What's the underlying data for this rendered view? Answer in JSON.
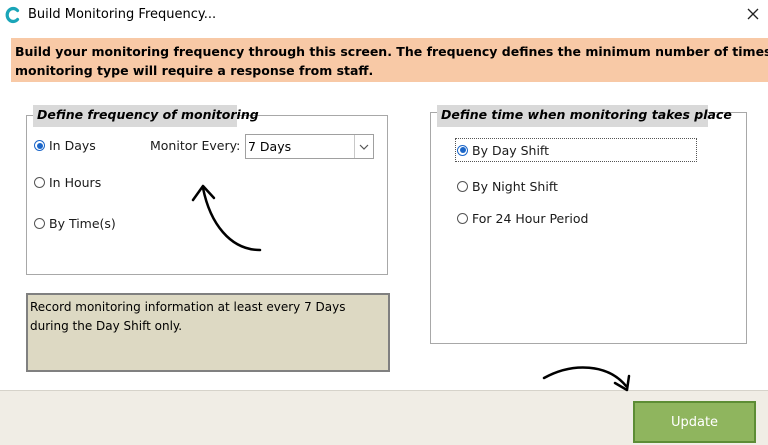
{
  "window": {
    "title": "Build Monitoring Frequency..."
  },
  "banner": {
    "line1": "Build your monitoring frequency through this screen.  The frequency defines the minimum number of times this",
    "line2": "monitoring type will require a response from staff."
  },
  "frequency_group": {
    "title": "Define frequency of monitoring",
    "options": [
      {
        "label": "In Days",
        "selected": true
      },
      {
        "label": "In Hours",
        "selected": false
      },
      {
        "label": "By Time(s)",
        "selected": false
      }
    ],
    "monitor_every_label": "Monitor Every:",
    "monitor_every_value": "7 Days"
  },
  "time_group": {
    "title": "Define time when monitoring takes place",
    "options": [
      {
        "label": "By Day Shift",
        "selected": true
      },
      {
        "label": "By Night Shift",
        "selected": false
      },
      {
        "label": "For 24 Hour Period",
        "selected": false
      }
    ]
  },
  "summary": {
    "text": "Record monitoring information at least every 7 Days during the Day Shift only."
  },
  "footer": {
    "update_label": "Update"
  },
  "colors": {
    "banner": "#f8c9a6",
    "summary_bg": "#ddd9c3",
    "update_btn": "#8fb55e",
    "radio_selected": "#1b66c9"
  },
  "icons": {
    "app": "app-logo-icon",
    "close": "close-icon",
    "dropdown": "chevron-down-icon"
  }
}
